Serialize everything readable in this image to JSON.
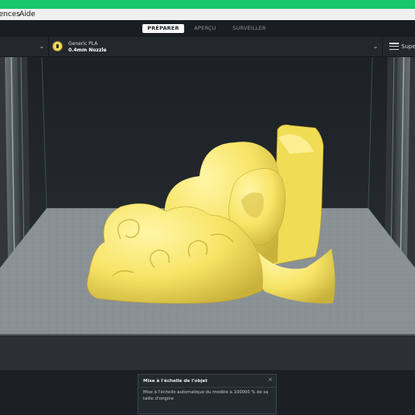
{
  "menubar": {
    "items": [
      "rences",
      "Aide"
    ]
  },
  "stages": [
    {
      "label": "PRÉPARER",
      "active": true
    },
    {
      "label": "APERÇU",
      "active": false
    },
    {
      "label": "SURVEILLER",
      "active": false
    }
  ],
  "toolbar": {
    "material_name": "Generic PLA",
    "nozzle": "0.4mm Nozzle",
    "profile_label": "Super"
  },
  "icons": {
    "left_dropdown": "chevron-down-icon",
    "material_dropdown": "chevron-down-icon",
    "material": "material-spool-icon",
    "settings": "settings-sliders-icon",
    "close": "close-icon"
  },
  "colors": {
    "title_bar": "#19c46b",
    "model": "#ffef7a",
    "active_tab_bg": "#ffffff"
  },
  "message": {
    "title": "Mise à l'échelle de l'objet",
    "body": "Mise à l'échelle automatique du modèle à 100000 % de sa taille d'origine",
    "close": "×"
  }
}
